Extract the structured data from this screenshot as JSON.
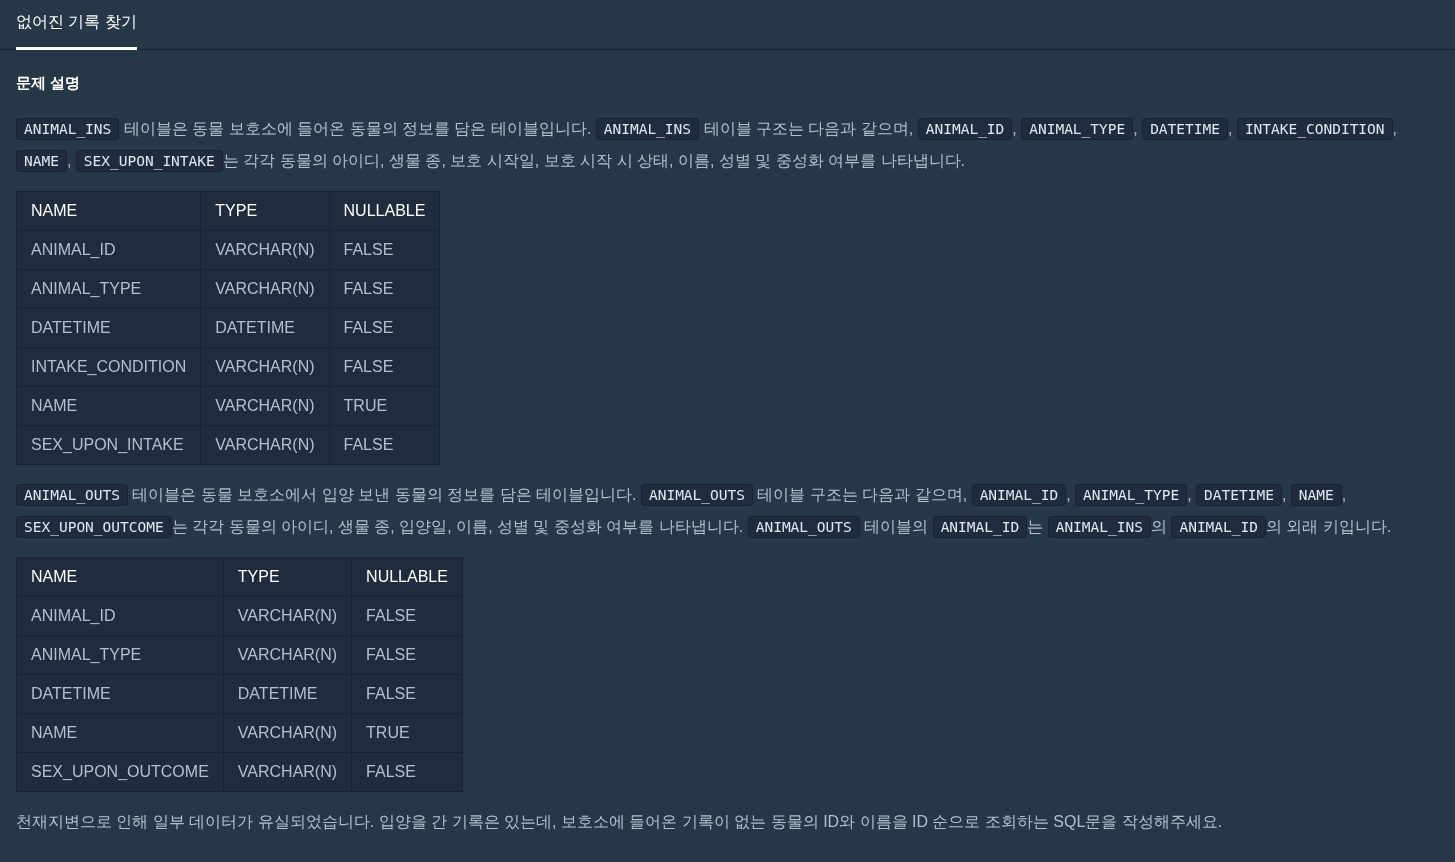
{
  "tabs": [
    {
      "label": "없어진 기록 찾기",
      "selected": true
    }
  ],
  "section_title": "문제 설명",
  "content": [
    {
      "kind": "paragraph",
      "parts": [
        {
          "kind": "code",
          "text": "ANIMAL_INS"
        },
        {
          "kind": "text",
          "text": " 테이블은 동물 보호소에 들어온 동물의 정보를 담은 테이블입니다. "
        },
        {
          "kind": "code",
          "text": "ANIMAL_INS"
        },
        {
          "kind": "text",
          "text": " 테이블 구조는 다음과 같으며, "
        },
        {
          "kind": "code",
          "text": "ANIMAL_ID"
        },
        {
          "kind": "text",
          "text": ", "
        },
        {
          "kind": "code",
          "text": "ANIMAL_TYPE"
        },
        {
          "kind": "text",
          "text": ", "
        },
        {
          "kind": "code",
          "text": "DATETIME"
        },
        {
          "kind": "text",
          "text": ", "
        },
        {
          "kind": "code",
          "text": "INTAKE_CONDITION"
        },
        {
          "kind": "text",
          "text": ", "
        },
        {
          "kind": "code",
          "text": "NAME"
        },
        {
          "kind": "text",
          "text": ", "
        },
        {
          "kind": "code",
          "text": "SEX_UPON_INTAKE"
        },
        {
          "kind": "text",
          "text": "는 각각 동물의 아이디, 생물 종, 보호 시작일, 보호 시작 시 상태, 이름, 성별 및 중성화 여부를 나타냅니다."
        }
      ]
    },
    {
      "kind": "table",
      "columns": [
        "NAME",
        "TYPE",
        "NULLABLE"
      ],
      "rows": [
        [
          "ANIMAL_ID",
          "VARCHAR(N)",
          "FALSE"
        ],
        [
          "ANIMAL_TYPE",
          "VARCHAR(N)",
          "FALSE"
        ],
        [
          "DATETIME",
          "DATETIME",
          "FALSE"
        ],
        [
          "INTAKE_CONDITION",
          "VARCHAR(N)",
          "FALSE"
        ],
        [
          "NAME",
          "VARCHAR(N)",
          "TRUE"
        ],
        [
          "SEX_UPON_INTAKE",
          "VARCHAR(N)",
          "FALSE"
        ]
      ]
    },
    {
      "kind": "paragraph",
      "parts": [
        {
          "kind": "code",
          "text": "ANIMAL_OUTS"
        },
        {
          "kind": "text",
          "text": " 테이블은 동물 보호소에서 입양 보낸 동물의 정보를 담은 테이블입니다. "
        },
        {
          "kind": "code",
          "text": "ANIMAL_OUTS"
        },
        {
          "kind": "text",
          "text": " 테이블 구조는 다음과 같으며, "
        },
        {
          "kind": "code",
          "text": "ANIMAL_ID"
        },
        {
          "kind": "text",
          "text": ", "
        },
        {
          "kind": "code",
          "text": "ANIMAL_TYPE"
        },
        {
          "kind": "text",
          "text": ", "
        },
        {
          "kind": "code",
          "text": "DATETIME"
        },
        {
          "kind": "text",
          "text": ", "
        },
        {
          "kind": "code",
          "text": "NAME"
        },
        {
          "kind": "text",
          "text": ", "
        },
        {
          "kind": "code",
          "text": "SEX_UPON_OUTCOME"
        },
        {
          "kind": "text",
          "text": "는 각각 동물의 아이디, 생물 종, 입양일, 이름, 성별 및 중성화 여부를 나타냅니다. "
        },
        {
          "kind": "code",
          "text": "ANIMAL_OUTS"
        },
        {
          "kind": "text",
          "text": " 테이블의 "
        },
        {
          "kind": "code",
          "text": "ANIMAL_ID"
        },
        {
          "kind": "text",
          "text": "는 "
        },
        {
          "kind": "code",
          "text": "ANIMAL_INS"
        },
        {
          "kind": "text",
          "text": "의 "
        },
        {
          "kind": "code",
          "text": "ANIMAL_ID"
        },
        {
          "kind": "text",
          "text": "의 외래 키입니다."
        }
      ]
    },
    {
      "kind": "table",
      "columns": [
        "NAME",
        "TYPE",
        "NULLABLE"
      ],
      "rows": [
        [
          "ANIMAL_ID",
          "VARCHAR(N)",
          "FALSE"
        ],
        [
          "ANIMAL_TYPE",
          "VARCHAR(N)",
          "FALSE"
        ],
        [
          "DATETIME",
          "DATETIME",
          "FALSE"
        ],
        [
          "NAME",
          "VARCHAR(N)",
          "TRUE"
        ],
        [
          "SEX_UPON_OUTCOME",
          "VARCHAR(N)",
          "FALSE"
        ]
      ]
    },
    {
      "kind": "paragraph",
      "parts": [
        {
          "kind": "text",
          "text": "천재지변으로 인해 일부 데이터가 유실되었습니다. 입양을 간 기록은 있는데, 보호소에 들어온 기록이 없는 동물의 ID와 이름을 ID 순으로 조회하는 SQL문을 작성해주세요."
        }
      ]
    }
  ]
}
